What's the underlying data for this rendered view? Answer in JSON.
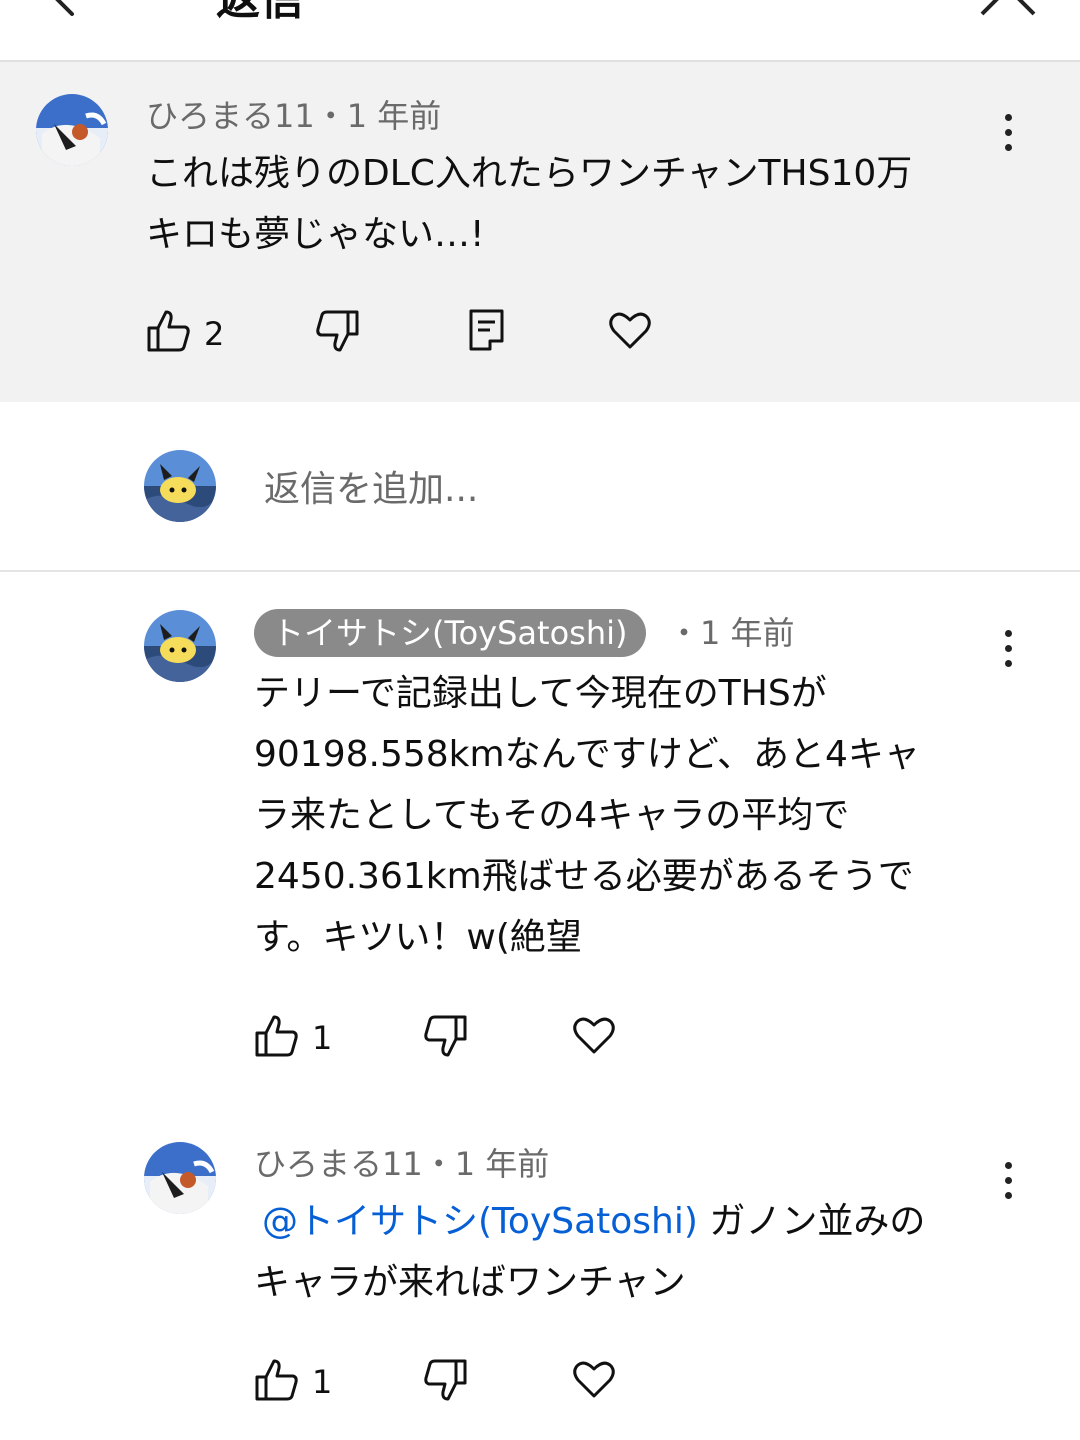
{
  "header": {
    "title": "返信"
  },
  "parent_comment": {
    "author": "ひろまる11",
    "time": "・1 年前",
    "text_lines": [
      "これは残りのDLC入れたらワンチャンTHS10万",
      "キロも夢じゃない…!"
    ],
    "likes": "2"
  },
  "add_reply": {
    "placeholder": "返信を追加..."
  },
  "replies": [
    {
      "author": "トイサトシ(ToySatoshi)",
      "time": "・1 年前",
      "text_lines": [
        "テリーで記録出して今現在のTHSが",
        "90198.558kmなんですけど、あと4キャ",
        "ラ来たとしてもその4キャラの平均で",
        "2450.361km飛ばせる必要があるそうで",
        "す。キツい！w(絶望"
      ],
      "likes": "1"
    },
    {
      "author": "ひろまる11",
      "time": "・1 年前",
      "mention": "@トイサトシ(ToySatoshi)",
      "text_line1_rest": " ガノン並みの",
      "text_line2": "キャラが来ればワンチャン",
      "likes": "1"
    }
  ],
  "icons": {
    "back": "chevron-left-icon",
    "close": "close-icon",
    "more": "more-vert-icon",
    "like": "thumb-up-icon",
    "dislike": "thumb-down-icon",
    "reply": "reply-icon",
    "heart": "heart-icon"
  },
  "colors": {
    "parent_background": "#f2f2f2",
    "mention_link": "#065fd4",
    "author_chip": "#8a8a8a",
    "meta_text": "#6a6a6a"
  }
}
